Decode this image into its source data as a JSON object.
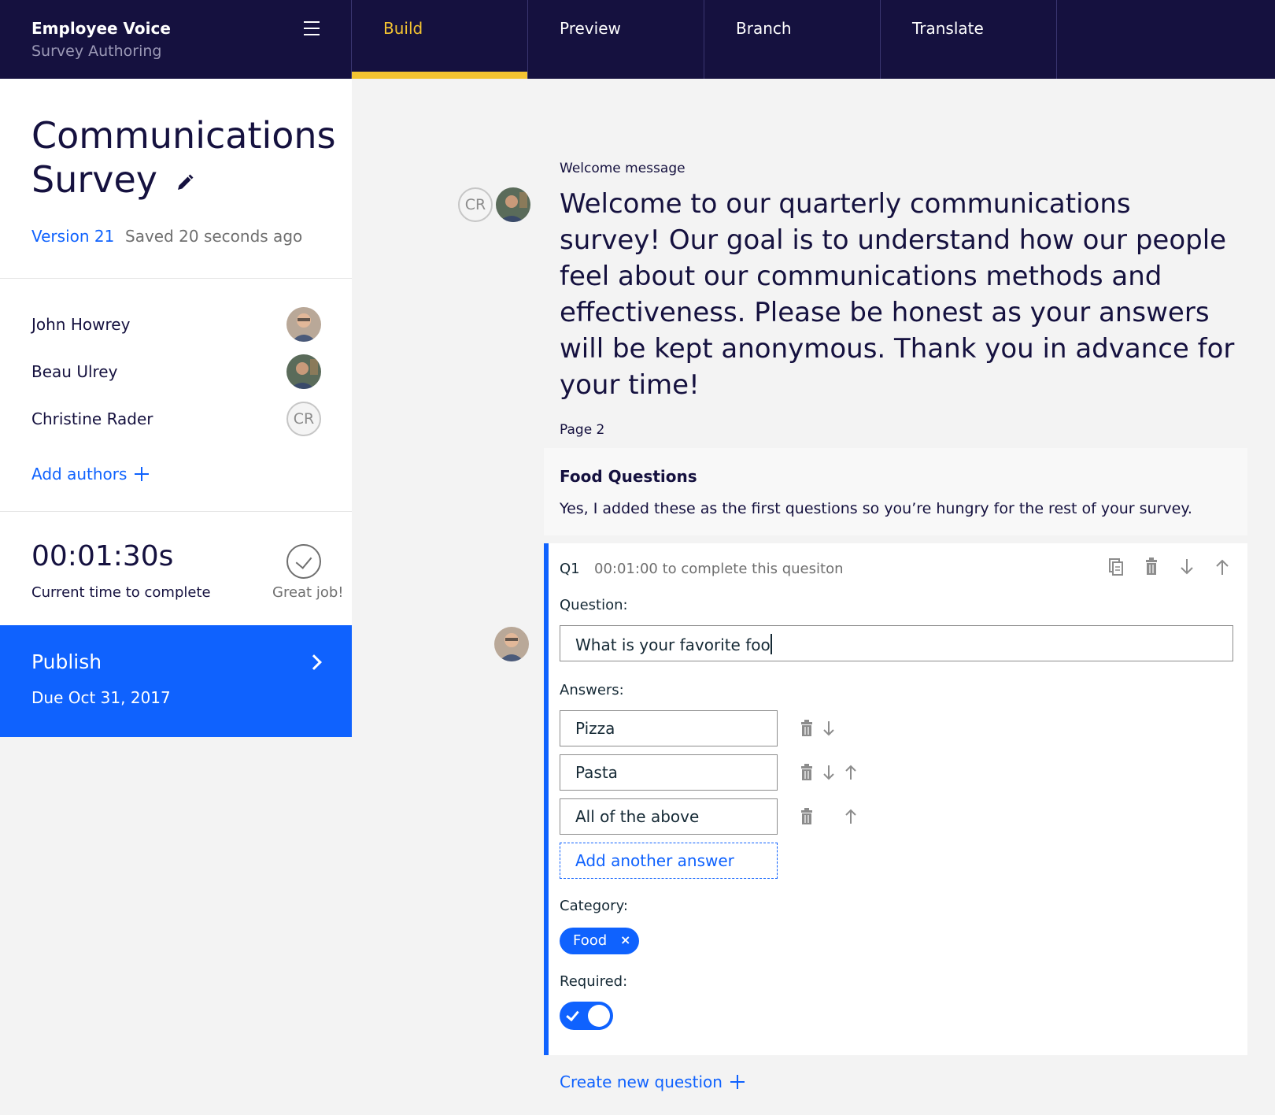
{
  "header": {
    "app_name": "Employee Voice",
    "app_subtitle": "Survey Authoring",
    "tabs": [
      {
        "label": "Build",
        "active": true
      },
      {
        "label": "Preview",
        "active": false
      },
      {
        "label": "Branch",
        "active": false
      },
      {
        "label": "Translate",
        "active": false
      }
    ]
  },
  "sidebar": {
    "survey_title": "Communications Survey",
    "version": "Version 21",
    "saved": "Saved 20 seconds ago",
    "authors": [
      {
        "name": "John Howrey",
        "avatar": "photo"
      },
      {
        "name": "Beau Ulrey",
        "avatar": "photo"
      },
      {
        "name": "Christine Rader",
        "avatar": "initials",
        "initials": "CR"
      }
    ],
    "add_authors_label": "Add authors",
    "time_to_complete": "00:01:30s",
    "time_label": "Current time to complete",
    "status_label": "Great job!",
    "publish": {
      "label": "Publish",
      "due": "Due Oct 31, 2017"
    }
  },
  "main": {
    "welcome_label": "Welcome message",
    "welcome_avatar_initials": "CR",
    "welcome_message": "Welcome to our quarterly communications survey! Our goal is to understand how our people feel about our communications methods and effectiveness. Please be honest as your answers will be kept anonymous. Thank you in advance for your time!",
    "page_label": "Page 2",
    "page_title": "Food Questions",
    "page_description": "Yes, I added these as the first questions so you’re hungry for the rest of your survey.",
    "question": {
      "number": "Q1",
      "time": "00:01:00 to complete this quesiton",
      "question_label": "Question:",
      "question_value": "What is your favorite foo",
      "answers_label": "Answers:",
      "answers": [
        "Pizza",
        "Pasta",
        "All of the above"
      ],
      "add_answer_label": "Add another answer",
      "category_label": "Category:",
      "category_chip": "Food",
      "chip_remove": "×",
      "required_label": "Required:",
      "required": true
    },
    "create_question_label": "Create new question"
  },
  "colors": {
    "nav_bg": "#15113f",
    "accent": "#0f62fe",
    "active_tab": "#f4c431"
  }
}
